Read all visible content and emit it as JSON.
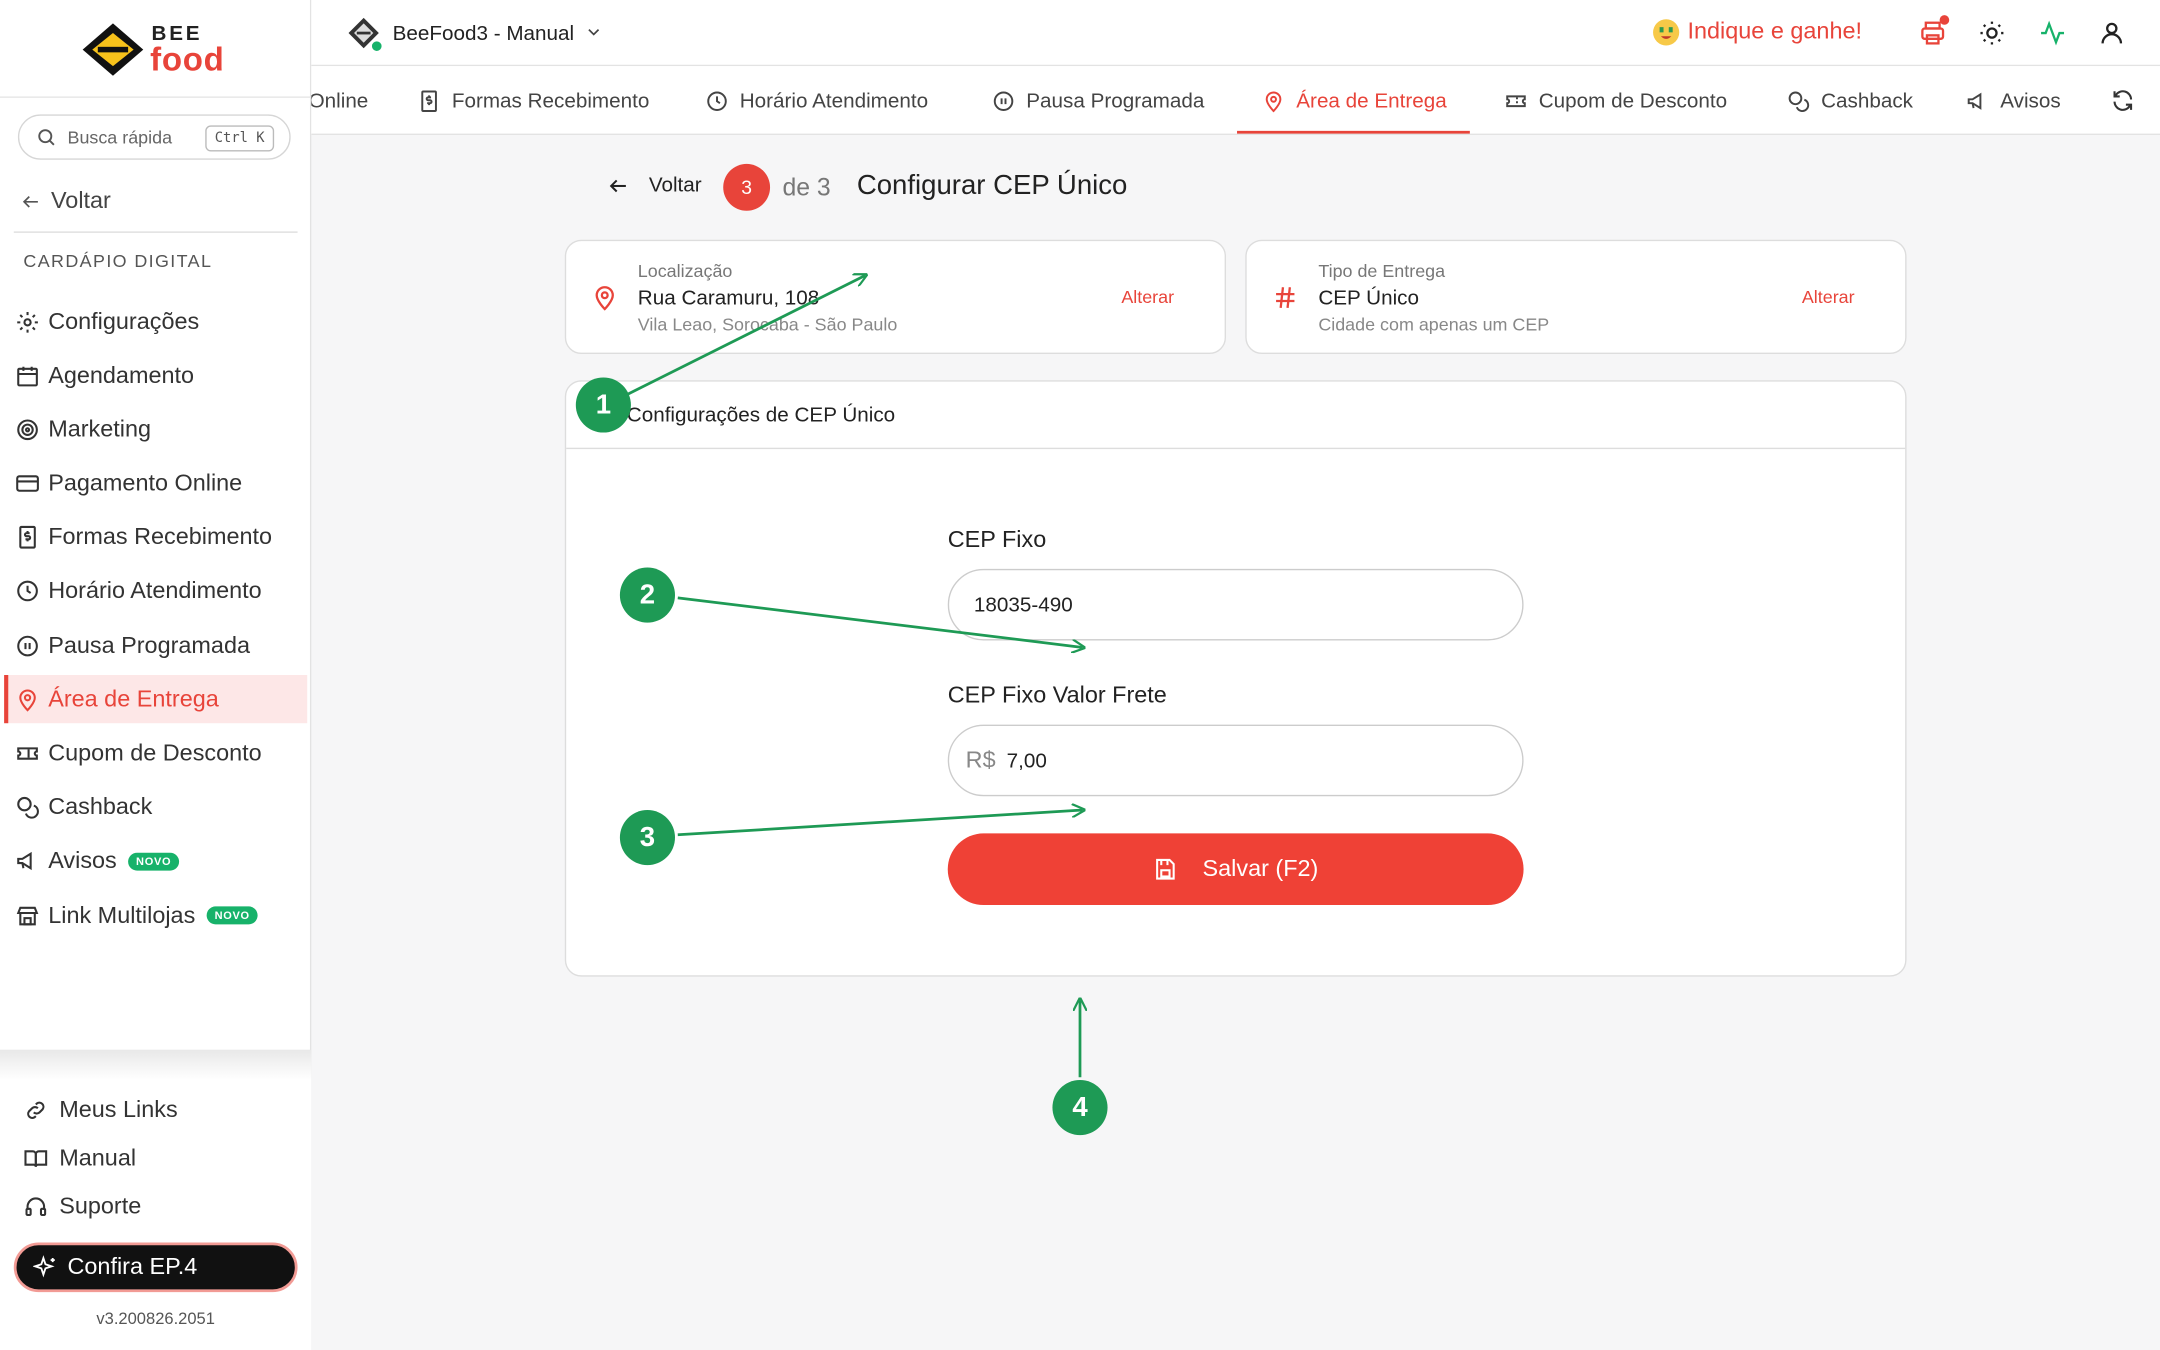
{
  "app": {
    "logo_top": "BEE",
    "logo_bottom": "food",
    "store_name": "BeeFood3 - Manual",
    "version": "v3.200826.2051"
  },
  "sidebar": {
    "search_placeholder": "Busca rápida",
    "search_shortcut": "Ctrl K",
    "back_label": "Voltar",
    "section_title": "CARDÁPIO DIGITAL",
    "items": [
      {
        "label": "Configurações",
        "icon": "gear-icon"
      },
      {
        "label": "Agendamento",
        "icon": "calendar-icon"
      },
      {
        "label": "Marketing",
        "icon": "target-icon"
      },
      {
        "label": "Pagamento Online",
        "icon": "credit-card-icon"
      },
      {
        "label": "Formas Recebimento",
        "icon": "receipt-icon"
      },
      {
        "label": "Horário Atendimento",
        "icon": "clock-icon"
      },
      {
        "label": "Pausa Programada",
        "icon": "pause-icon"
      },
      {
        "label": "Área de Entrega",
        "icon": "map-pin-icon",
        "active": true
      },
      {
        "label": "Cupom de Desconto",
        "icon": "ticket-icon"
      },
      {
        "label": "Cashback",
        "icon": "coins-icon"
      },
      {
        "label": "Avisos",
        "icon": "megaphone-icon",
        "badge": "NOVO"
      },
      {
        "label": "Link Multilojas",
        "icon": "store-icon",
        "badge": "NOVO"
      }
    ],
    "bottom_links": [
      {
        "label": "Meus Links",
        "icon": "link-icon"
      },
      {
        "label": "Manual",
        "icon": "book-icon"
      },
      {
        "label": "Suporte",
        "icon": "headset-icon"
      }
    ],
    "promo_label": "Confira EP.4"
  },
  "header": {
    "indique_label": "Indique e ganhe!",
    "icons": [
      "printer-icon",
      "sun-icon",
      "activity-icon",
      "user-icon"
    ]
  },
  "tabs": [
    {
      "label": "Online",
      "icon": ""
    },
    {
      "label": "Formas Recebimento",
      "icon": "receipt-icon"
    },
    {
      "label": "Horário Atendimento",
      "icon": "clock-icon"
    },
    {
      "label": "Pausa Programada",
      "icon": "pause-icon"
    },
    {
      "label": "Área de Entrega",
      "icon": "map-pin-icon",
      "active": true
    },
    {
      "label": "Cupom de Desconto",
      "icon": "ticket-icon"
    },
    {
      "label": "Cashback",
      "icon": "coins-icon"
    },
    {
      "label": "Avisos",
      "icon": "megaphone-icon"
    }
  ],
  "wizard": {
    "back_label": "Voltar",
    "step": "3",
    "of_label": "de 3",
    "title": "Configurar CEP Único"
  },
  "location_card": {
    "label": "Localização",
    "value": "Rua Caramuru, 108",
    "sub": "Vila Leao, Sorocaba - São Paulo",
    "action": "Alterar"
  },
  "delivery_card": {
    "label": "Tipo de Entrega",
    "value": "CEP Único",
    "sub": "Cidade com apenas um CEP",
    "action": "Alterar"
  },
  "config": {
    "title": "Configurações de CEP Único",
    "cep_label": "CEP Fixo",
    "cep_value": "18035-490",
    "freight_label": "CEP Fixo Valor Frete",
    "currency": "R$",
    "freight_value": "7,00",
    "save_label": "Salvar (F2)"
  },
  "annotations": [
    "1",
    "2",
    "3",
    "4"
  ],
  "colors": {
    "accent": "#e8443a",
    "marker": "#1e9a55",
    "save": "#ef4136"
  }
}
